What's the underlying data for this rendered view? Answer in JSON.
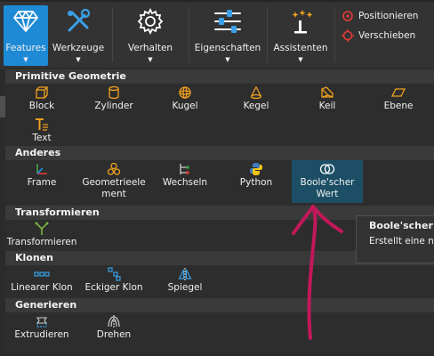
{
  "ribbon": {
    "features": "Features",
    "werkzeuge": "Werkzeuge",
    "verhalten": "Verhalten",
    "eigenschaften": "Eigenschaften",
    "assistenten": "Assistenten",
    "arrow": "▼",
    "positionieren": "Positionieren",
    "verschieben": "Verschieben"
  },
  "sections": {
    "primitive": {
      "title": "Primitive Geometrie",
      "items": [
        "Block",
        "Zylinder",
        "Kugel",
        "Kegel",
        "Keil",
        "Ebene",
        "Text"
      ]
    },
    "anderes": {
      "title": "Anderes",
      "items": [
        "Frame",
        "Geometrieelement",
        "Wechseln",
        "Python",
        "Boole'scher Wert"
      ]
    },
    "transformieren": {
      "title": "Transformieren",
      "items": [
        "Transformieren"
      ]
    },
    "klonen": {
      "title": "Klonen",
      "items": [
        "Linearer Klon",
        "Eckiger Klon",
        "Spiegel"
      ]
    },
    "generieren": {
      "title": "Generieren",
      "items": [
        "Extrudieren",
        "Drehen"
      ]
    }
  },
  "tooltip": {
    "title": "Boole'scher W",
    "body": "Erstellt eine ne"
  },
  "colors": {
    "accent": "#1e8ad6",
    "selected": "#1c4f66",
    "annotation": "#c2185b",
    "icon_orange": "#f0a020"
  }
}
